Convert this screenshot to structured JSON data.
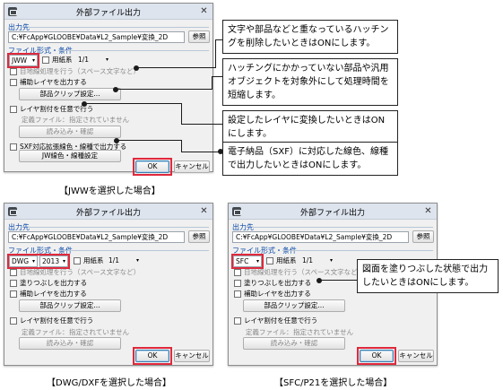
{
  "dialog_title": "外部ファイル出力",
  "output_section": "出力先",
  "output_path": "C:¥FcApp¥GLOOBE¥Data¥L2_Sample¥変換_2D",
  "browse_button": "参照",
  "format_section": "ファイル形式・条件",
  "paper_label": "用紙系",
  "paper_value": "1/1",
  "hidden_line": "目地線処理を行う（スペース文字など）",
  "fill_label": "塗りつぶしを出力する",
  "aux_layer": "補助レイヤを出力する",
  "parts_clip_button": "部品クリップ設定...",
  "layer_assign": "レイヤ割付を任意で行う",
  "def_file_label": "定義ファイル：",
  "def_file_value": "指定されていません",
  "load_button": "読み込み・確認",
  "sxf_label": "SXF対応拡張線色・線種で出力する",
  "jw_button": "JW線色・線種設定",
  "ok": "OK",
  "cancel": "キャンセル",
  "dlg1": {
    "format": "JWW"
  },
  "dlg2": {
    "format": "DWG",
    "version": "2013"
  },
  "dlg3": {
    "format": "SFC"
  },
  "callouts": {
    "c1": "文字や部品などと重なっているハッチングを削除したいときはONにします。",
    "c2": "ハッチングにかかっていない部品や汎用オブジェクトを対象外にして処理時間を短縮します。",
    "c3": "設定したレイヤに変換したいときはONにします。",
    "c4": "電子納品（SXF）に対応した線色、線種で出力したいときはONにします。",
    "c5": "図面を塗りつぶした状態で出力したいときはONにします。"
  },
  "captions": {
    "jww": "【JWWを選択した場合】",
    "dwg": "【DWG/DXFを選択した場合】",
    "sfc": "【SFC/P21を選択した場合】"
  },
  "colors": {
    "highlight": "#e0293c",
    "section": "#0a4aa8"
  }
}
